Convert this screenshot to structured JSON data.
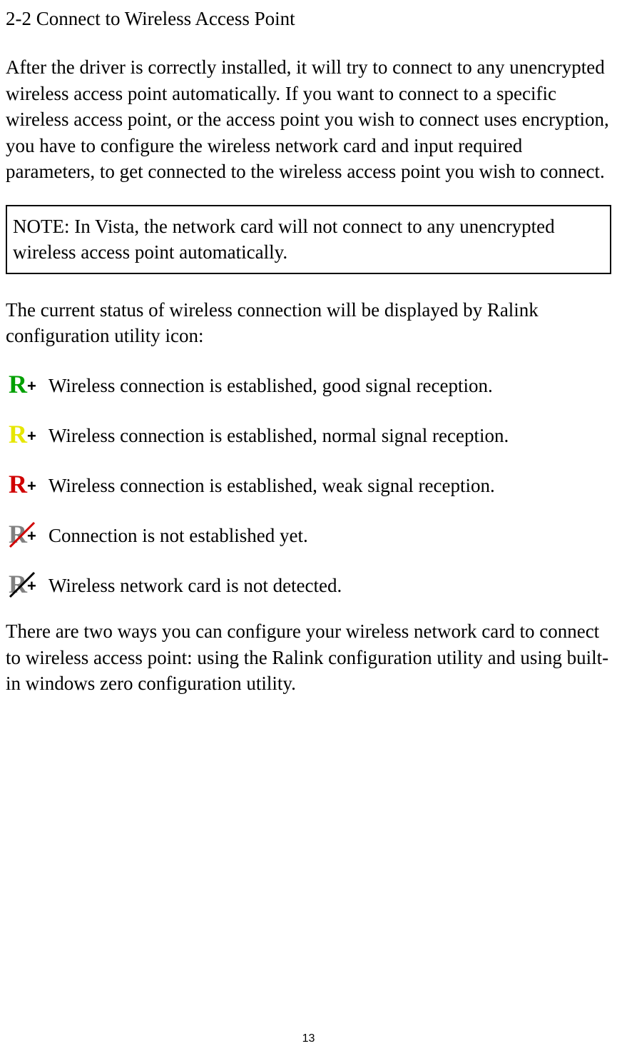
{
  "section_title": "2-2 Connect to Wireless Access Point",
  "paragraph1": "After the driver is correctly installed, it will try to connect to any unencrypted wireless access point automatically. If you want to connect to a specific wireless access point, or the access point you wish to connect uses encryption, you have to configure the wireless network card and input required parameters, to get connected to the wireless access point you wish to connect.",
  "note_text": "NOTE: In Vista, the network card will not connect to any unencrypted wireless access point automatically.",
  "paragraph2": "The current status of wireless connection will be displayed by Ralink configuration utility icon:",
  "icons": [
    {
      "name": "signal-good-icon",
      "label": "Wireless connection is established, good signal reception.",
      "color": "#00a000"
    },
    {
      "name": "signal-normal-icon",
      "label": "Wireless connection is established, normal signal reception.",
      "color": "#e6e600"
    },
    {
      "name": "signal-weak-icon",
      "label": "Wireless connection is established, weak signal reception.",
      "color": "#d00000"
    },
    {
      "name": "not-connected-icon",
      "label": "Connection is not established yet.",
      "color": "#808080"
    },
    {
      "name": "not-detected-icon",
      "label": "Wireless network card is not detected.",
      "color": "#808080"
    }
  ],
  "paragraph3": "There are two ways you can configure your wireless network card to connect to wireless access point: using the Ralink configuration utility and using built-in windows zero configuration utility.",
  "page_number": "13"
}
